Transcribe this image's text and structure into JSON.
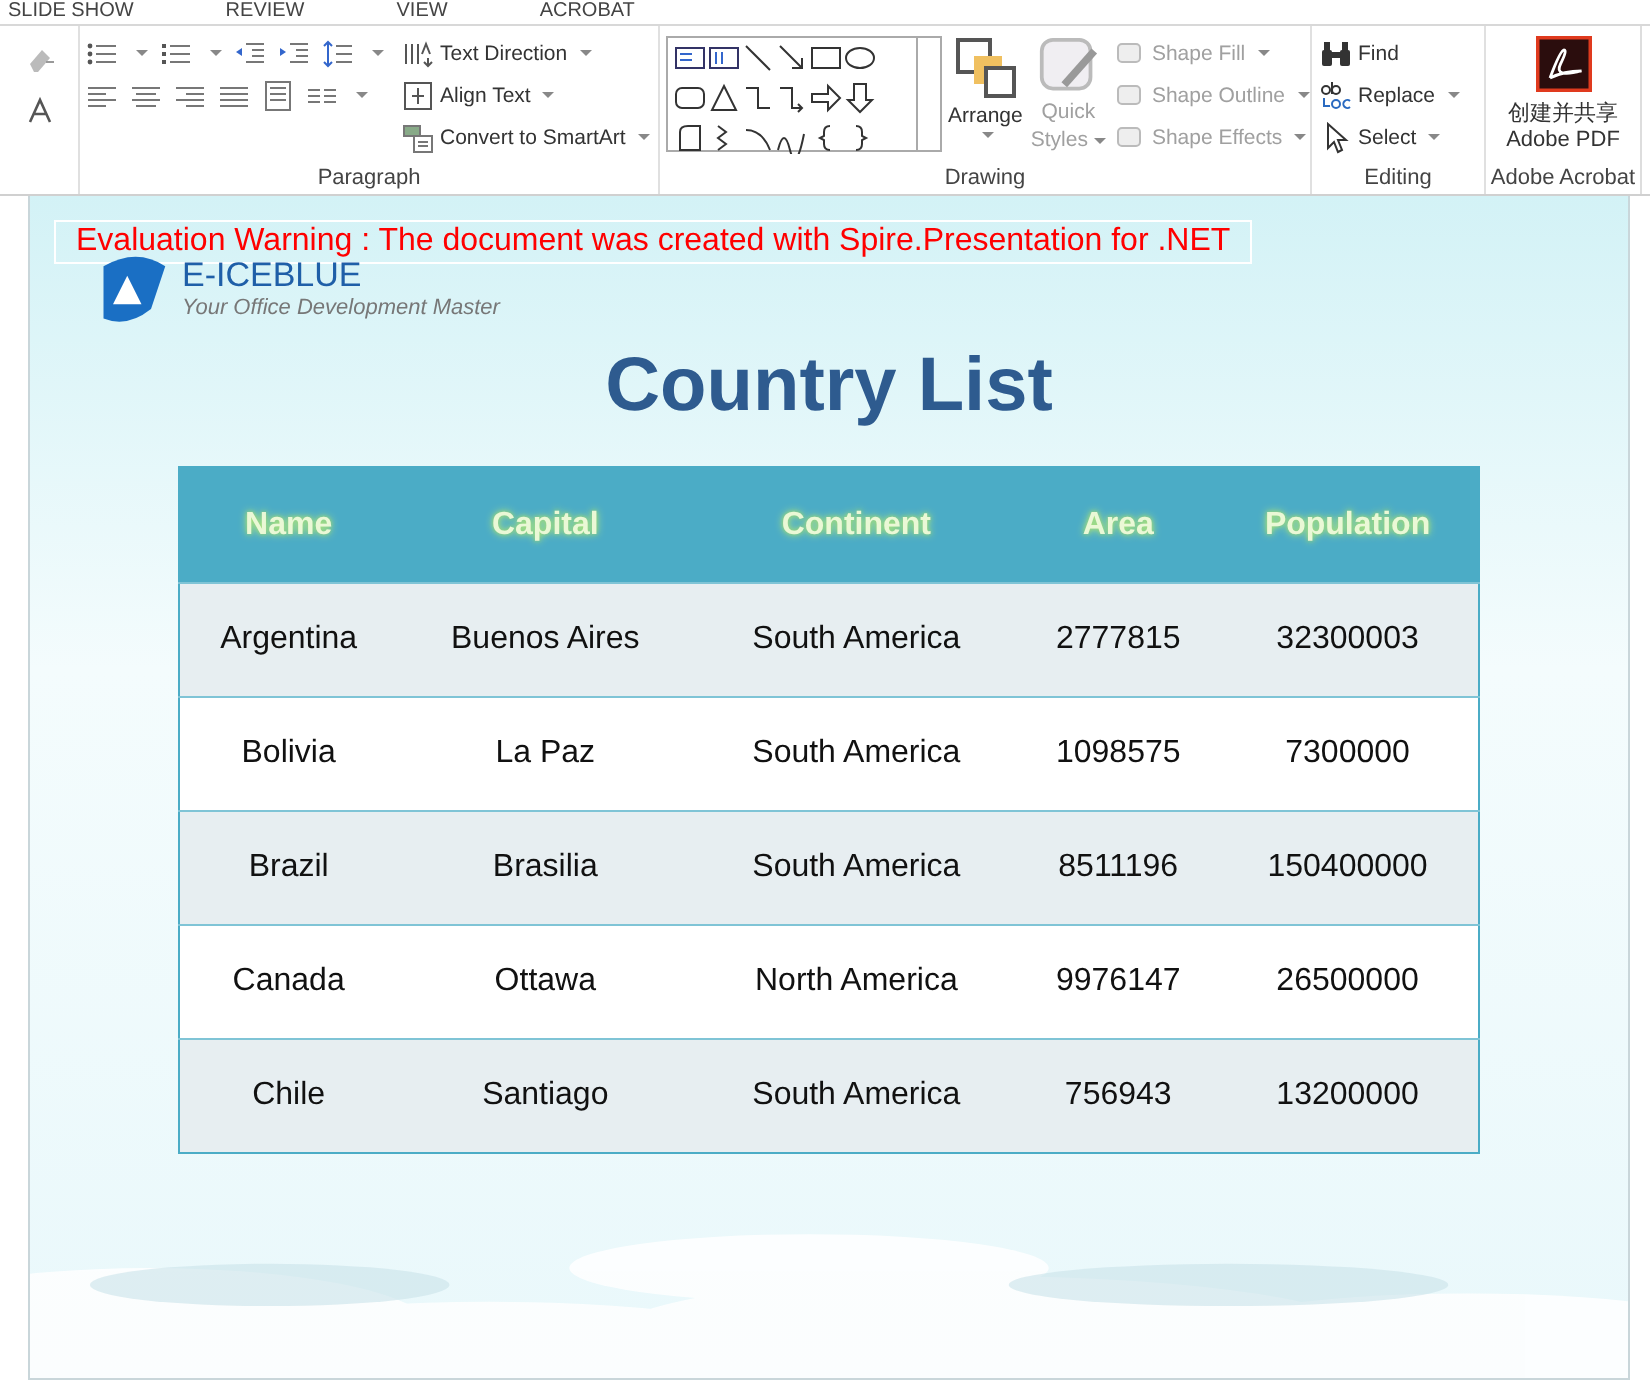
{
  "ribbon_tabs": [
    "SLIDE SHOW",
    "REVIEW",
    "VIEW",
    "ACROBAT"
  ],
  "paragraph_group": {
    "commands": [
      {
        "label": "Text Direction"
      },
      {
        "label": "Align Text"
      },
      {
        "label": "Convert to SmartArt"
      }
    ],
    "label": "Paragraph"
  },
  "drawing_group": {
    "arrange": {
      "label": "Arrange"
    },
    "quick_styles": {
      "label_lines": [
        "Quick",
        "Styles"
      ],
      "disabled": true
    },
    "commands": [
      {
        "label": "Shape Fill",
        "disabled": true
      },
      {
        "label": "Shape Outline",
        "disabled": true
      },
      {
        "label": "Shape Effects",
        "disabled": true
      }
    ],
    "label": "Drawing"
  },
  "editing_group": {
    "commands": [
      {
        "label": "Find",
        "dropdown": false
      },
      {
        "label": "Replace",
        "dropdown": true
      },
      {
        "label": "Select",
        "dropdown": true
      }
    ],
    "label": "Editing"
  },
  "acrobat_group": {
    "button_lines": [
      "创建并共享",
      "Adobe PDF"
    ],
    "label": "Adobe Acrobat"
  },
  "slide": {
    "warning": "Evaluation Warning : The document was created with  Spire.Presentation for .NET",
    "logo": {
      "name": "E-ICEBLUE",
      "tagline": "Your Office Development Master"
    },
    "title": "Country List",
    "table": {
      "columns": [
        "Name",
        "Capital",
        "Continent",
        "Area",
        "Population"
      ],
      "rows": [
        [
          "Argentina",
          "Buenos Aires",
          "South America",
          "2777815",
          "32300003"
        ],
        [
          "Bolivia",
          "La Paz",
          "South America",
          "1098575",
          "7300000"
        ],
        [
          "Brazil",
          "Brasilia",
          "South America",
          "8511196",
          "150400000"
        ],
        [
          "Canada",
          "Ottawa",
          "North America",
          "9976147",
          "26500000"
        ],
        [
          "Chile",
          "Santiago",
          "South America",
          "756943",
          "13200000"
        ]
      ]
    }
  }
}
